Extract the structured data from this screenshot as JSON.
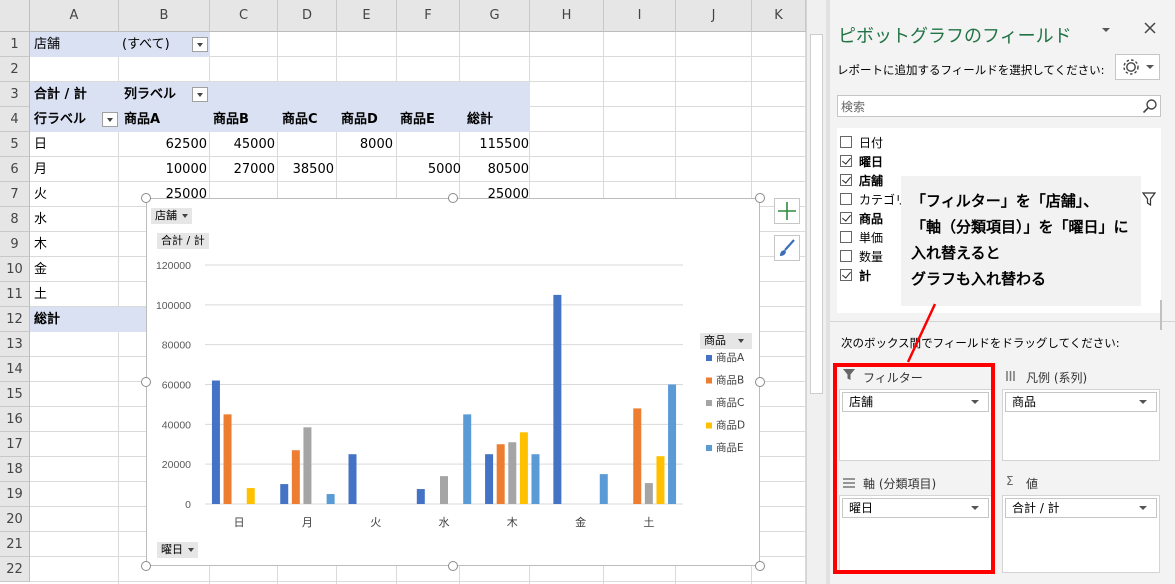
{
  "sheet": {
    "columns": [
      "A",
      "B",
      "C",
      "D",
      "E",
      "F",
      "G",
      "H",
      "I",
      "J",
      "K"
    ],
    "rows": [
      "1",
      "2",
      "3",
      "4",
      "5",
      "6",
      "7",
      "8",
      "9",
      "10",
      "11",
      "12",
      "13",
      "14",
      "15",
      "16",
      "17",
      "18",
      "19",
      "20",
      "21",
      "22"
    ],
    "filter_label": "店舗",
    "filter_value": "(すべて)",
    "sum_label": "合計 / 計",
    "col_labels": "列ラベル",
    "row_labels": "行ラベル",
    "col_heads": [
      "商品A",
      "商品B",
      "商品C",
      "商品D",
      "商品E",
      "総計"
    ],
    "data_rows": [
      {
        "label": "日",
        "values": [
          "62500",
          "45000",
          "",
          "8000",
          "",
          "115500"
        ]
      },
      {
        "label": "月",
        "values": [
          "10000",
          "27000",
          "38500",
          "",
          "5000",
          "80500"
        ]
      },
      {
        "label": "火",
        "values": [
          "25000",
          "",
          "",
          "",
          "",
          "25000"
        ]
      },
      {
        "label": "水",
        "values": [
          "",
          "",
          "",
          "",
          "",
          ""
        ]
      },
      {
        "label": "木",
        "values": [
          "",
          "",
          "",
          "",
          "",
          ""
        ]
      },
      {
        "label": "金",
        "values": [
          "",
          "",
          "",
          "",
          "",
          ""
        ]
      },
      {
        "label": "土",
        "values": [
          "",
          "",
          "",
          "",
          "",
          ""
        ]
      }
    ],
    "total_label": "総計"
  },
  "chart": {
    "filter_button": "店舗",
    "value_button": "合計 / 計",
    "axis_button": "曜日",
    "legend_button": "商品",
    "colors": [
      "#4472c4",
      "#ed7d31",
      "#a5a5a5",
      "#ffc000",
      "#5b9bd5"
    ]
  },
  "chart_data": {
    "type": "bar",
    "categories": [
      "日",
      "月",
      "火",
      "水",
      "木",
      "金",
      "土"
    ],
    "ylim": [
      0,
      120000
    ],
    "yticks": [
      "0",
      "20000",
      "40000",
      "60000",
      "80000",
      "100000",
      "120000"
    ],
    "series": [
      {
        "name": "商品A",
        "values": [
          62000,
          10000,
          25000,
          7500,
          25000,
          105000,
          0
        ]
      },
      {
        "name": "商品B",
        "values": [
          45000,
          27000,
          0,
          0,
          30000,
          0,
          48000
        ]
      },
      {
        "name": "商品C",
        "values": [
          0,
          38500,
          0,
          14000,
          31000,
          0,
          10500
        ]
      },
      {
        "name": "商品D",
        "values": [
          8000,
          0,
          0,
          0,
          36000,
          0,
          24000
        ]
      },
      {
        "name": "商品E",
        "values": [
          0,
          5000,
          0,
          45000,
          25000,
          15000,
          60000
        ]
      }
    ],
    "legend": "right"
  },
  "pane": {
    "title": "ピボットグラフのフィールド",
    "subtitle": "レポートに追加するフィールドを選択してください:",
    "search_placeholder": "検索",
    "fields": [
      {
        "label": "日付",
        "checked": false,
        "bold": false
      },
      {
        "label": "曜日",
        "checked": true,
        "bold": true
      },
      {
        "label": "店舗",
        "checked": true,
        "bold": true
      },
      {
        "label": "カテゴリ",
        "checked": false,
        "bold": false
      },
      {
        "label": "商品",
        "checked": true,
        "bold": true
      },
      {
        "label": "単価",
        "checked": false,
        "bold": false
      },
      {
        "label": "数量",
        "checked": false,
        "bold": false
      },
      {
        "label": "計",
        "checked": true,
        "bold": true
      }
    ],
    "drag_hint": "次のボックス間でフィールドをドラッグしてください:",
    "filter_area": {
      "title": "フィルター",
      "value": "店舗"
    },
    "legend_area": {
      "title": "凡例 (系列)",
      "value": "商品"
    },
    "axis_area": {
      "title": "軸 (分類項目)",
      "value": "曜日"
    },
    "values_area": {
      "title": "値",
      "value": "合計 / 計"
    }
  },
  "callout": {
    "lines": [
      "「フィルター」を「店舗」、",
      "「軸（分類項目）」を「曜日」に",
      "入れ替えると",
      "グラフも入れ替わる"
    ],
    "highlight_color": "#ff0000"
  }
}
